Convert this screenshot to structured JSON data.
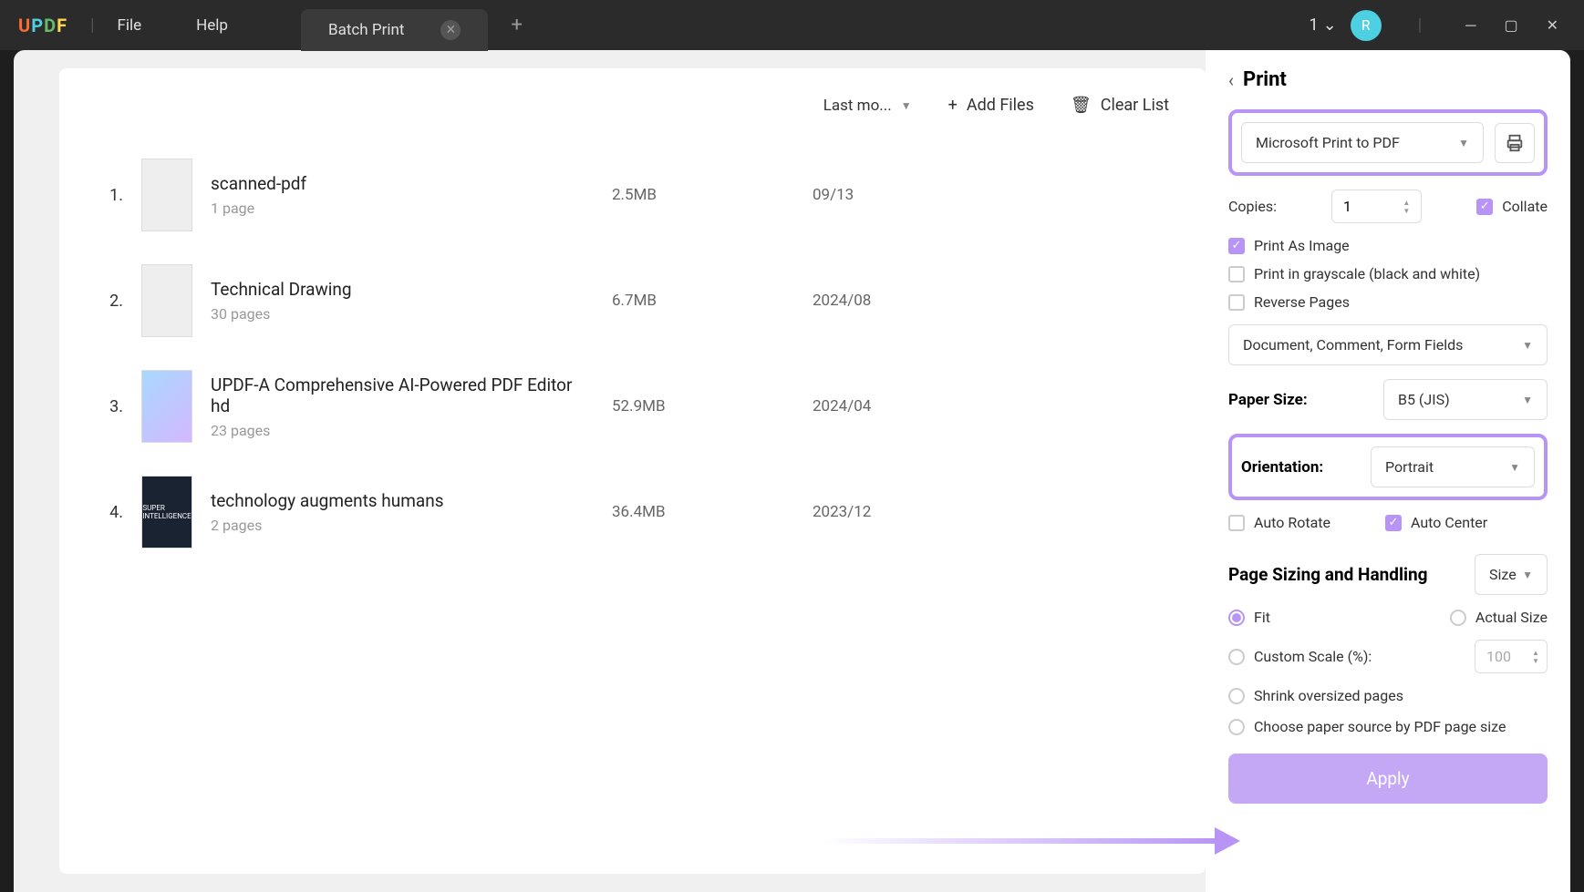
{
  "titlebar": {
    "file_menu": "File",
    "help_menu": "Help",
    "tab_title": "Batch Print",
    "window_count": "1",
    "avatar_letter": "R"
  },
  "toolbar": {
    "sort_label": "Last mo...",
    "add_files": "Add Files",
    "clear_list": "Clear List"
  },
  "files": [
    {
      "num": "1.",
      "name": "scanned-pdf",
      "pages": "1 page",
      "size": "2.5MB",
      "date": "09/13"
    },
    {
      "num": "2.",
      "name": "Technical Drawing",
      "pages": "30 pages",
      "size": "6.7MB",
      "date": "2024/08"
    },
    {
      "num": "3.",
      "name": "UPDF-A Comprehensive AI-Powered PDF Editor hd",
      "pages": "23 pages",
      "size": "52.9MB",
      "date": "2024/04"
    },
    {
      "num": "4.",
      "name": "technology augments humans",
      "pages": "2 pages",
      "size": "36.4MB",
      "date": "2023/12"
    }
  ],
  "print": {
    "title": "Print",
    "printer": "Microsoft Print to PDF",
    "copies_label": "Copies:",
    "copies_value": "1",
    "collate": "Collate",
    "print_as_image": "Print As Image",
    "grayscale": "Print in grayscale (black and white)",
    "reverse": "Reverse Pages",
    "comments_dd": "Document, Comment, Form Fields",
    "paper_size_label": "Paper Size:",
    "paper_size_value": "B5 (JIS)",
    "orientation_label": "Orientation:",
    "orientation_value": "Portrait",
    "auto_rotate": "Auto Rotate",
    "auto_center": "Auto Center",
    "sizing_title": "Page Sizing and Handling",
    "sizing_dd": "Size",
    "fit": "Fit",
    "actual_size": "Actual Size",
    "custom_scale": "Custom Scale (%):",
    "custom_scale_value": "100",
    "shrink": "Shrink oversized pages",
    "paper_source": "Choose paper source by PDF page size",
    "apply": "Apply"
  }
}
